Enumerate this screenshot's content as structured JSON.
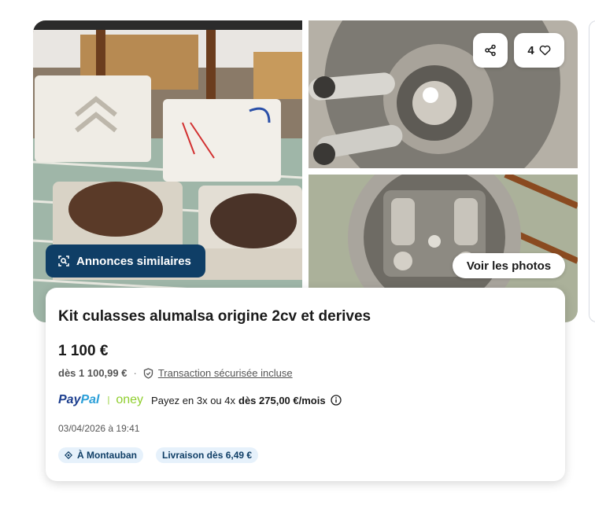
{
  "listing": {
    "title": "Kit culasses alumalsa origine 2cv et derives",
    "price": "1 100 €",
    "price_with_protection": "dès 1 100,99 €",
    "separator": "·",
    "protection_label": "Transaction sécurisée incluse",
    "date": "03/04/2026 à 19:41"
  },
  "gallery": {
    "similar_button_label": "Annonces similaires",
    "see_photos_label": "Voir les photos",
    "favorite_count": "4",
    "share_icon": "share-icon",
    "heart_icon": "heart-icon"
  },
  "payment": {
    "paypal_part1": "Pay",
    "paypal_part2": "Pal",
    "divider": "|",
    "oney_label": "oney",
    "installments_text": "Payez en 3x ou 4x",
    "installment_amount": "dès 275,00 €/mois"
  },
  "tags": {
    "location": "À Montauban",
    "delivery": "Livraison dès 6,49 €"
  },
  "colors": {
    "brand_dark": "#0f3e66",
    "tag_bg": "#e6f1fb",
    "paypal_blue": "#1d3f8f",
    "paypal_light": "#2a9fd8",
    "oney_green": "#8fce2e"
  }
}
